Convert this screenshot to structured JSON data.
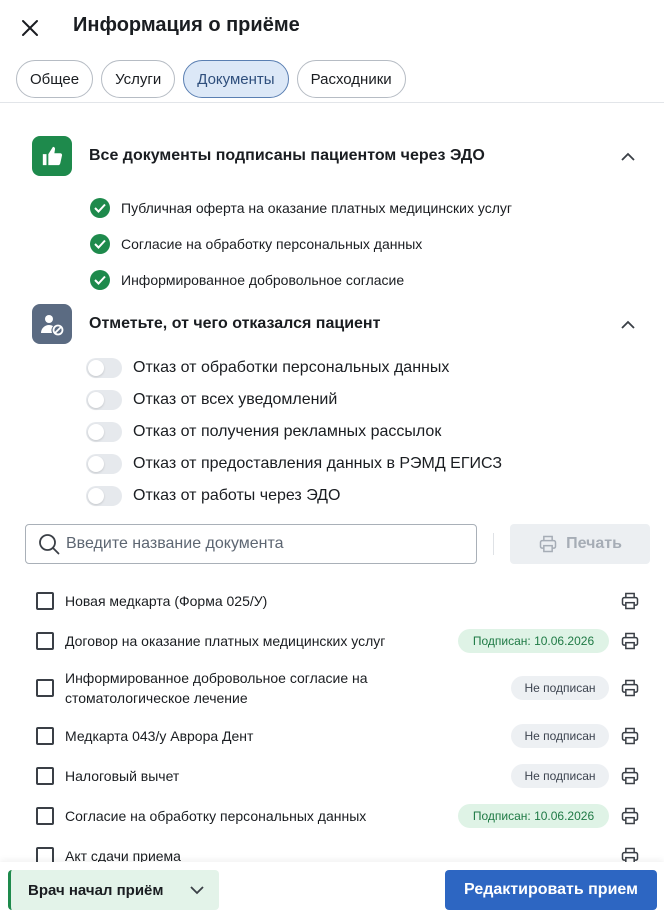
{
  "header": {
    "title": "Информация о приёме"
  },
  "tabs": [
    {
      "label": "Общее"
    },
    {
      "label": "Услуги"
    },
    {
      "label": "Документы"
    },
    {
      "label": "Расходники"
    }
  ],
  "signed_section": {
    "title": "Все документы подписаны пациентом через ЭДО",
    "items": [
      {
        "label": "Публичная оферта на оказание платных медицинских услуг"
      },
      {
        "label": "Согласие на обработку персональных данных"
      },
      {
        "label": "Информированное добровольное согласие"
      }
    ]
  },
  "refusal_section": {
    "title": "Отметьте, от чего отказался пациент",
    "items": [
      {
        "label": "Отказ от обработки персональных данных"
      },
      {
        "label": "Отказ от всех уведомлений"
      },
      {
        "label": "Отказ от получения рекламных рассылок"
      },
      {
        "label": "Отказ от предоставления данных в РЭМД ЕГИСЗ"
      },
      {
        "label": "Отказ от работы через ЭДО"
      }
    ]
  },
  "search": {
    "placeholder": "Введите название документа",
    "value": ""
  },
  "print_button": {
    "label": "Печать"
  },
  "documents": [
    {
      "name": "Новая медкарта (Форма 025/У)",
      "status": ""
    },
    {
      "name": "Договор на оказание платных медицинских услуг",
      "status": "Подписан: 10.06.2026"
    },
    {
      "name_line1": "Информированное добровольное согласие на",
      "name_line2": "стоматологическое лечение",
      "status": "Не подписан"
    },
    {
      "name": "Медкарта 043/у Аврора Дент",
      "status": "Не подписан"
    },
    {
      "name": "Налоговый вычет",
      "status": "Не подписан"
    },
    {
      "name": "Согласие на обработку персональных данных",
      "status": "Подписан: 10.06.2026"
    },
    {
      "name": "Акт сдачи приема",
      "status": ""
    }
  ],
  "footer": {
    "status_label": "Врач начал приём",
    "edit_label": "Редактировать прием"
  },
  "colors": {
    "accent": "#2d66c2",
    "success": "#1e8a4c",
    "tab_active_bg": "#dce8f7"
  }
}
